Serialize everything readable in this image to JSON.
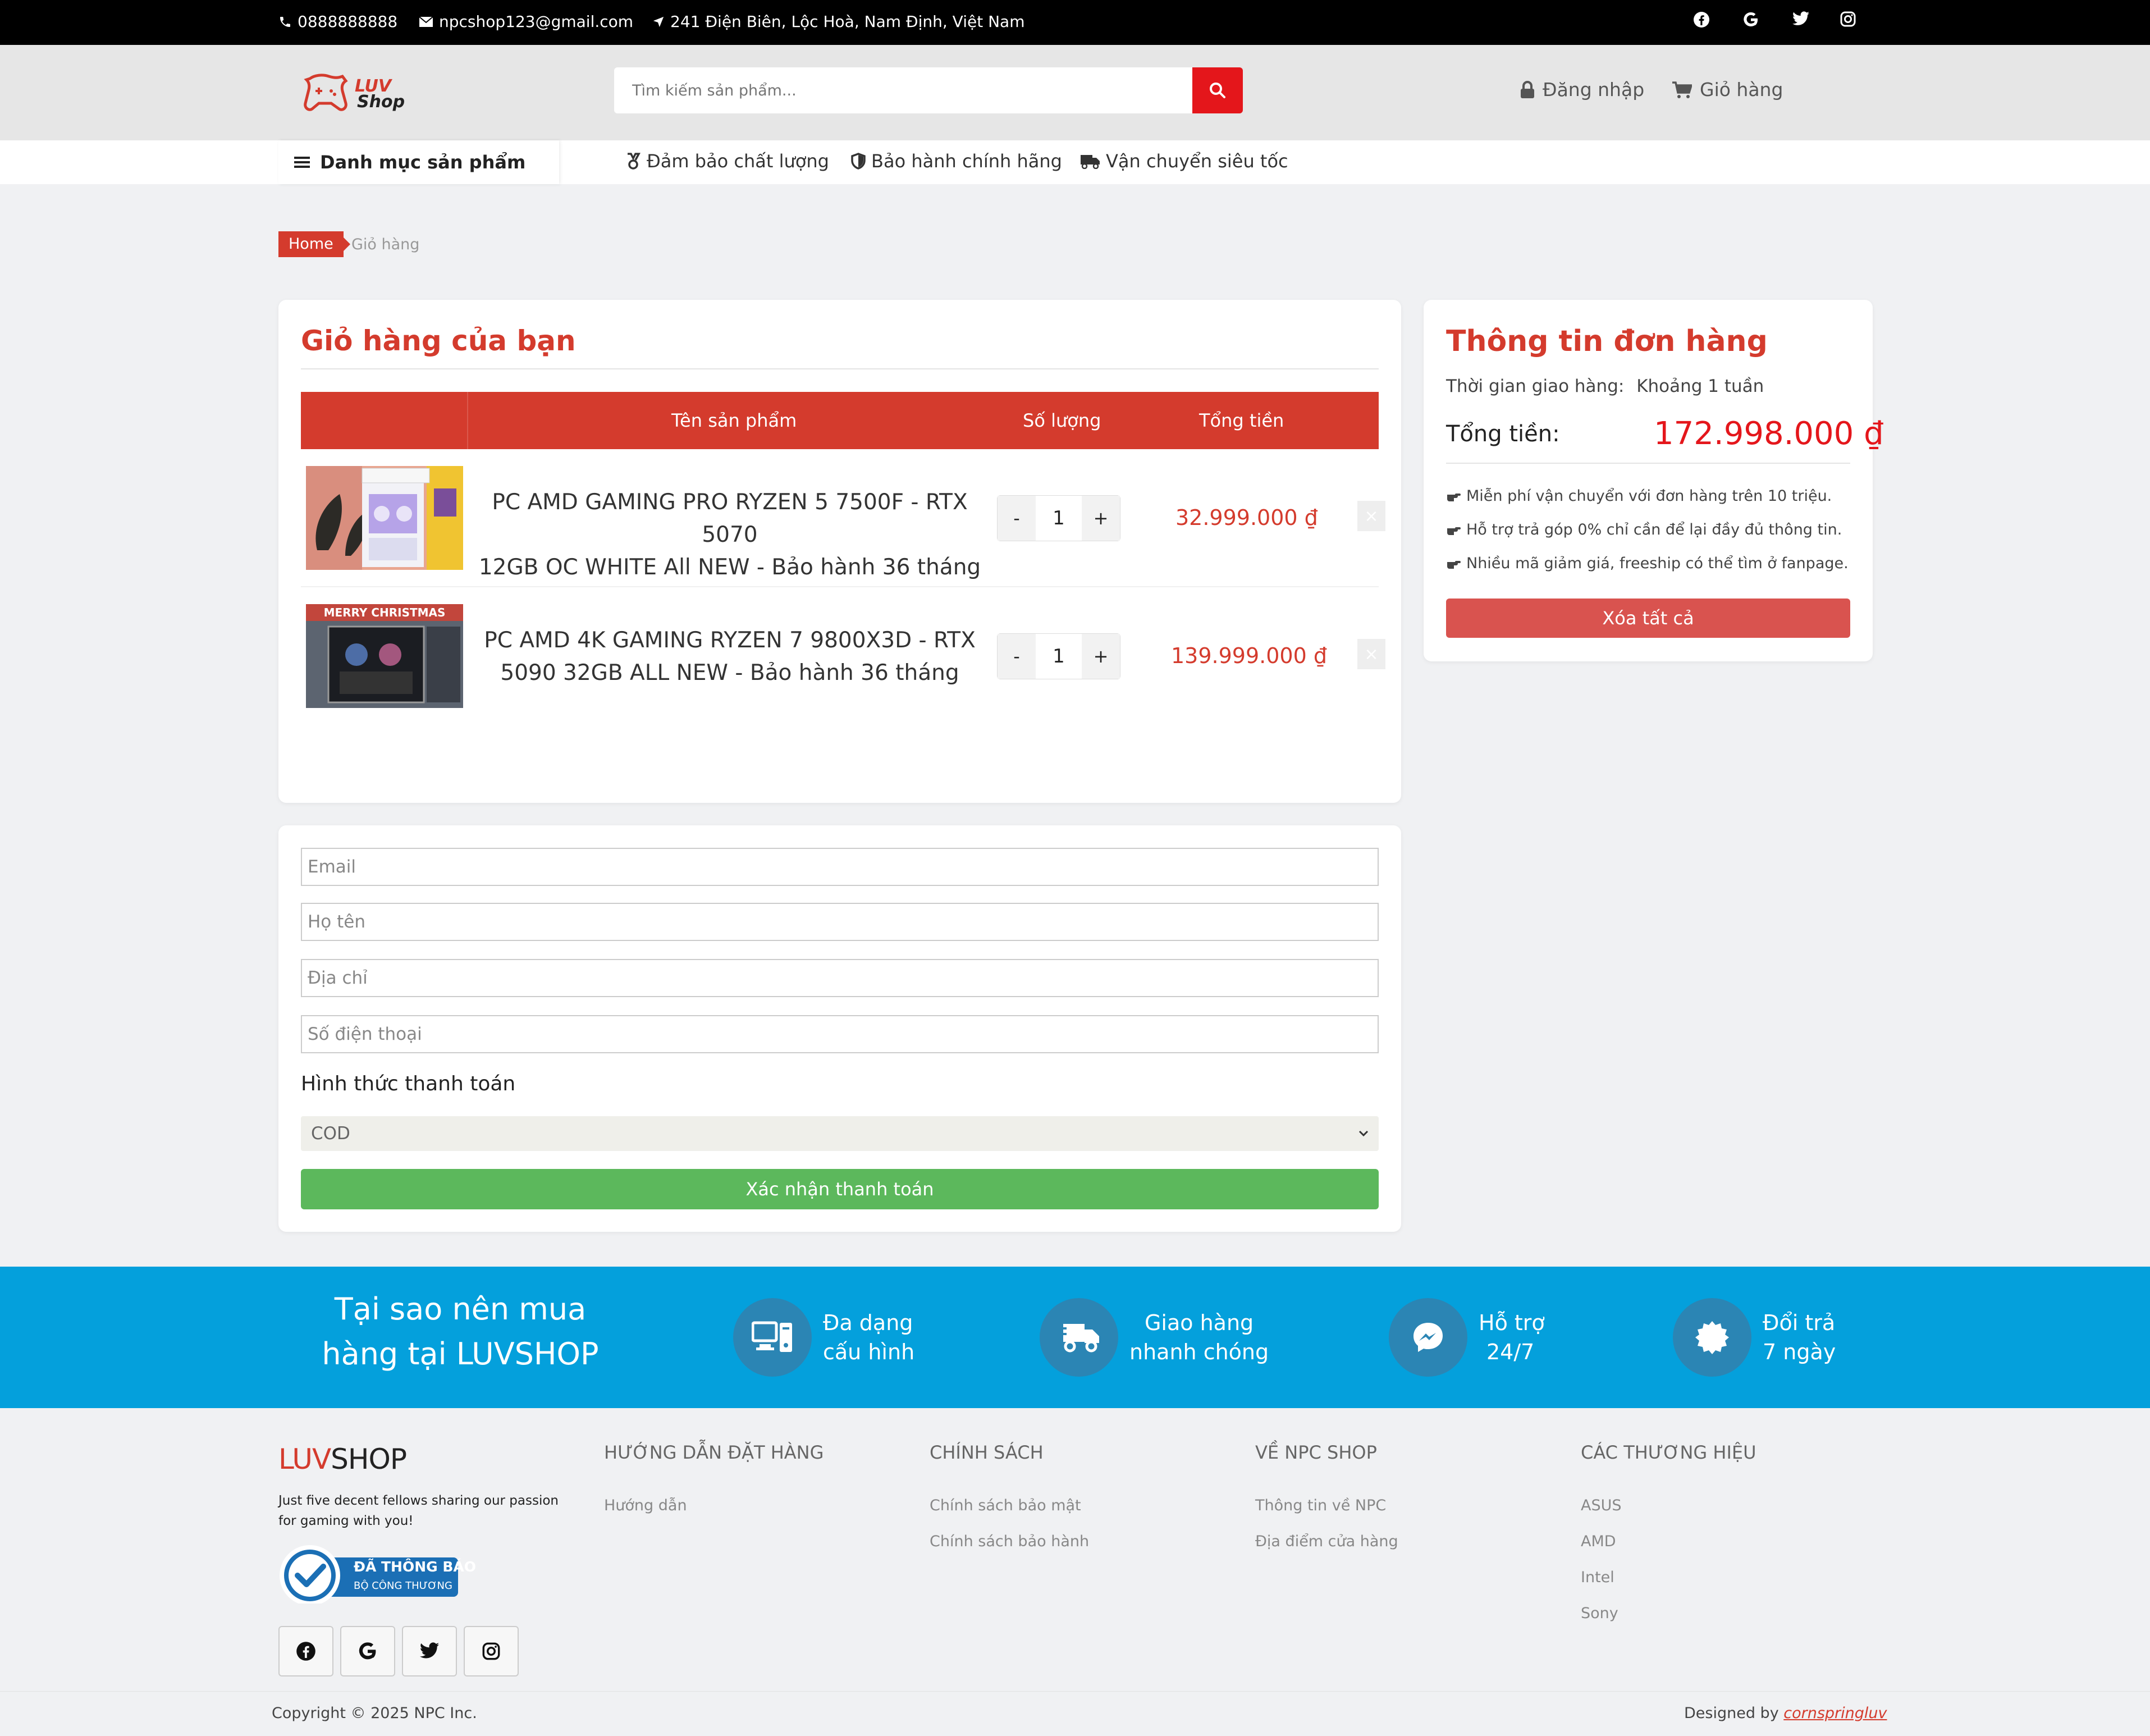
{
  "topbar": {
    "phone": "0888888888",
    "email": "npcshop123@gmail.com",
    "address": "241 Điện Biên, Lộc Hoà, Nam Định, Việt Nam",
    "social_icons": [
      "facebook-icon",
      "google-icon",
      "twitter-icon",
      "instagram-icon"
    ]
  },
  "header": {
    "logo_text_top": "LUV",
    "logo_text_bottom": "Shop",
    "search_placeholder": "Tìm kiếm sản phẩm...",
    "login_label": "Đăng nhập",
    "cart_label": "Giỏ hàng"
  },
  "nav": {
    "category_label": "Danh mục sản phẩm",
    "items": [
      {
        "label": "Đảm bảo chất lượng",
        "icon": "medal-icon"
      },
      {
        "label": "Bảo hành chính hãng",
        "icon": "shield-icon"
      },
      {
        "label": "Vận chuyển siêu tốc",
        "icon": "truck-icon"
      }
    ]
  },
  "breadcrumb": {
    "home": "Home",
    "current": "Giỏ hàng"
  },
  "cart": {
    "title": "Giỏ hàng của bạn",
    "columns": [
      "Tên sản phẩm",
      "Số lượng",
      "Tổng tiền"
    ],
    "items": [
      {
        "name_line1": "PC AMD GAMING PRO RYZEN 5 7500F - RTX 5070",
        "name_line2": "12GB OC WHITE All NEW - Bảo hành 36 tháng",
        "quantity": "1",
        "total": "32.999.000 ₫"
      },
      {
        "name_line1": "PC AMD 4K GAMING RYZEN 7 9800X3D - RTX",
        "name_line2": "5090 32GB ALL NEW - Bảo hành 36 tháng",
        "quantity": "1",
        "total": "139.999.000 ₫"
      }
    ],
    "minus": "-",
    "plus": "+",
    "remove": "×",
    "thumb2_banner": "MERRY CHRISTMAS"
  },
  "order": {
    "title": "Thông tin đơn hàng",
    "delivery_label": "Thời gian giao hàng:",
    "delivery_value": "Khoảng 1 tuần",
    "total_label": "Tổng tiền:",
    "total_value": "172.998.000 ₫",
    "notes": [
      "Miễn phí vận chuyển với đơn hàng trên 10 triệu.",
      "Hỗ trợ trả góp 0% chỉ cần để lại đầy đủ thông tin.",
      "Nhiều mã giảm giá, freeship có thể tìm ở fanpage."
    ],
    "clear_all": "Xóa tất cả"
  },
  "form": {
    "email_placeholder": "Email",
    "name_placeholder": "Họ tên",
    "address_placeholder": "Địa chỉ",
    "phone_placeholder": "Số điện thoại",
    "payment_label": "Hình thức thanh toán",
    "payment_selected": "COD",
    "submit": "Xác nhận thanh toán"
  },
  "why": {
    "title_line1": "Tại sao nên mua",
    "title_line2": "hàng tại LUVSHOP",
    "features": [
      {
        "line1": "Đa dạng",
        "line2": "cấu hình",
        "icon": "computer-icon"
      },
      {
        "line1": "Giao hàng",
        "line2": "nhanh chóng",
        "icon": "truck-fast-icon"
      },
      {
        "line1": "Hỗ trợ",
        "line2": "24/7",
        "icon": "messenger-icon"
      },
      {
        "line1": "Đổi trả",
        "line2": "7 ngày",
        "icon": "badge-icon"
      }
    ]
  },
  "footer": {
    "brand_a": "LUV",
    "brand_b": "SHOP",
    "tagline": "Just five decent fellows sharing our passion for gaming with you!",
    "badge_line1": "ĐÃ THÔNG BÁO",
    "badge_line2": "BỘ CÔNG THƯƠNG",
    "columns": [
      {
        "heading": "HƯỚNG DẪN ĐẶT HÀNG",
        "links": [
          "Hướng dẫn"
        ]
      },
      {
        "heading": "CHÍNH SÁCH",
        "links": [
          "Chính sách bảo mật",
          "Chính sách bảo hành"
        ]
      },
      {
        "heading": "VỀ NPC SHOP",
        "links": [
          "Thông tin về NPC",
          "Địa điểm cửa hàng"
        ]
      },
      {
        "heading": "CÁC THƯƠNG HIỆU",
        "links": [
          "ASUS",
          "AMD",
          "Intel",
          "Sony"
        ]
      }
    ],
    "copyright": "Copyright © 2025 NPC Inc.",
    "designed_by": "Designed by",
    "designer": "cornspringluv"
  },
  "colors": {
    "brand_red": "#d43b2d",
    "search_red": "#e4161b",
    "confirm_green": "#5cb85c",
    "why_blue": "#04a0dc",
    "topbar_black": "#000000"
  }
}
